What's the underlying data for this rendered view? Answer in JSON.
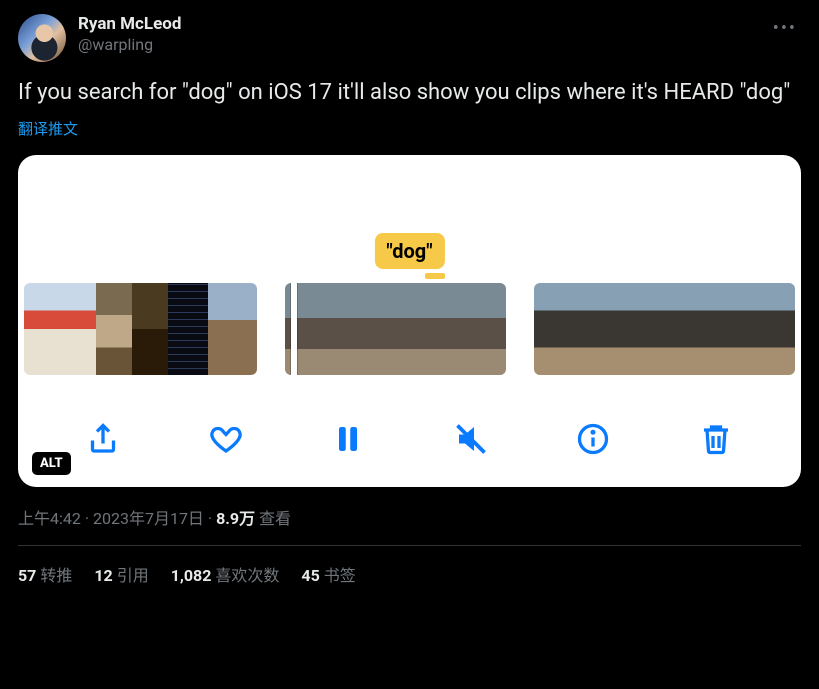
{
  "author": {
    "display_name": "Ryan McLeod",
    "handle": "@warpling"
  },
  "tweet_text": "If you search for \"dog\" on iOS 17 it'll also show you clips where it's HEARD \"dog\"",
  "translate_label": "翻译推文",
  "media": {
    "tooltip_text": "\"dog\"",
    "alt_badge": "ALT"
  },
  "meta": {
    "time": "上午4:42",
    "date": "2023年7月17日",
    "views_number": "8.9万",
    "views_label": "查看"
  },
  "stats": {
    "retweets": {
      "count": "57",
      "label": "转推"
    },
    "quotes": {
      "count": "12",
      "label": "引用"
    },
    "likes": {
      "count": "1,082",
      "label": "喜欢次数"
    },
    "bookmarks": {
      "count": "45",
      "label": "书签"
    }
  }
}
